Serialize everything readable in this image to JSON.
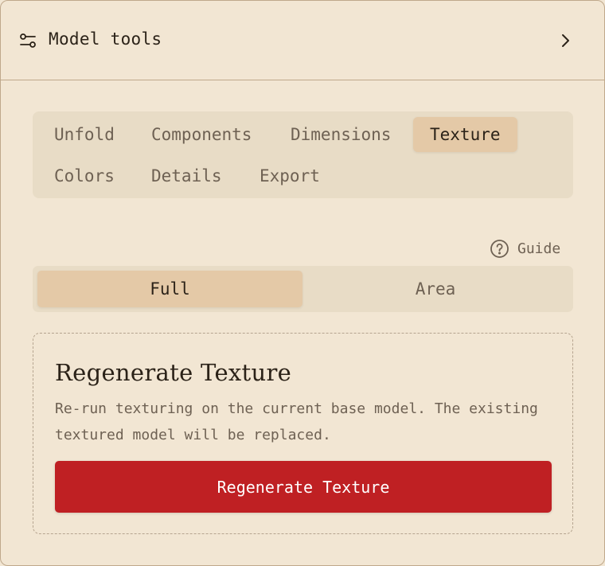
{
  "header": {
    "title": "Model tools",
    "icon": "sliders-icon",
    "toggle_icon": "chevron-right-icon"
  },
  "tabs": [
    {
      "label": "Unfold",
      "active": false
    },
    {
      "label": "Components",
      "active": false
    },
    {
      "label": "Dimensions",
      "active": false
    },
    {
      "label": "Texture",
      "active": true
    },
    {
      "label": "Colors",
      "active": false
    },
    {
      "label": "Details",
      "active": false
    },
    {
      "label": "Export",
      "active": false
    }
  ],
  "guide": {
    "label": "Guide",
    "icon": "help-circle-icon"
  },
  "mode": {
    "options": [
      {
        "label": "Full",
        "active": true
      },
      {
        "label": "Area",
        "active": false
      }
    ]
  },
  "card": {
    "title": "Regenerate Texture",
    "description": "Re-run texturing on the current base model. The existing textured model will be replaced.",
    "button_label": "Regenerate Texture"
  },
  "colors": {
    "background": "#f2e6d3",
    "active_tab": "#e4c9a7",
    "primary_button": "#bf2023"
  }
}
